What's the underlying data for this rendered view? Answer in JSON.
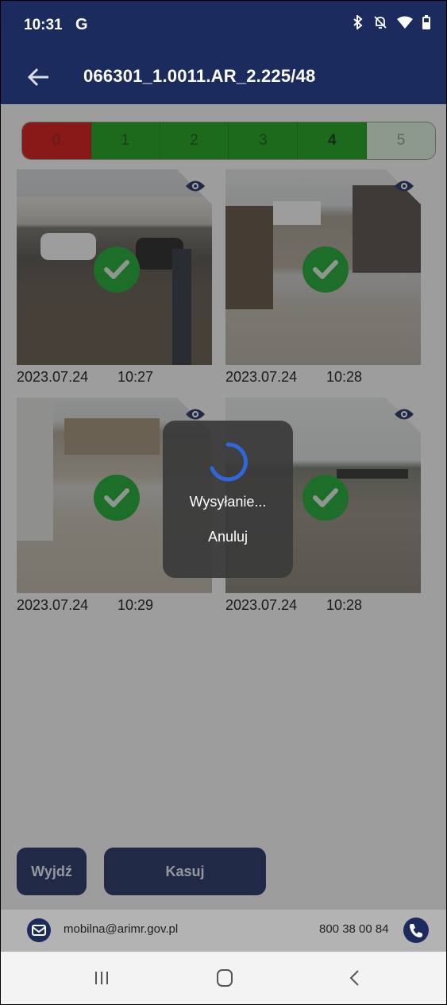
{
  "status_bar": {
    "time": "10:31",
    "carrier_icon": "G",
    "icons": [
      "bluetooth-icon",
      "mute-icon",
      "wifi-icon",
      "battery-icon"
    ]
  },
  "app_bar": {
    "title": "066301_1.0011.AR_2.225/48",
    "back_icon": "arrow-left-icon"
  },
  "rating": {
    "options": [
      "0",
      "1",
      "2",
      "3",
      "4",
      "5"
    ],
    "selected": "4"
  },
  "photos": [
    {
      "date": "2023.07.24",
      "time": "10:27",
      "status_icon": "check-icon",
      "view_icon": "eye-icon"
    },
    {
      "date": "2023.07.24",
      "time": "10:28",
      "status_icon": "check-icon",
      "view_icon": "eye-icon"
    },
    {
      "date": "2023.07.24",
      "time": "10:29",
      "status_icon": "check-icon",
      "view_icon": "eye-icon"
    },
    {
      "date": "2023.07.24",
      "time": "10:28",
      "status_icon": "check-icon",
      "view_icon": "eye-icon"
    }
  ],
  "dialog": {
    "message": "Wysyłanie...",
    "cancel_label": "Anuluj"
  },
  "actions": {
    "exit_label": "Wyjdź",
    "delete_label": "Kasuj"
  },
  "footer": {
    "email": "mobilna@arimr.gov.pl",
    "phone": "800 38 00 84"
  },
  "colors": {
    "navy": "#1b2b5e",
    "green": "#149a14",
    "red": "#cf0f0f",
    "check_green": "#14a02a"
  }
}
